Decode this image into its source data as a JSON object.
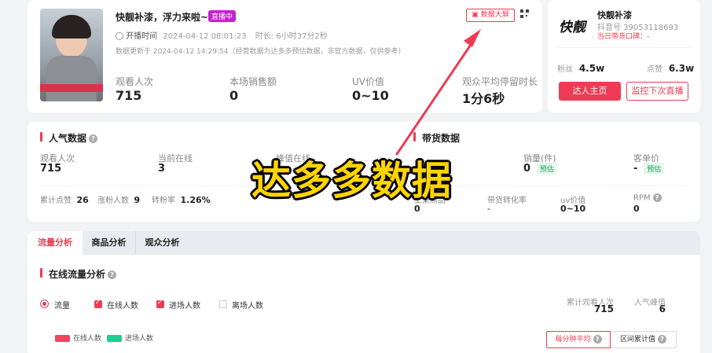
{
  "live": {
    "title": "快靓补漆，浮力来啦~",
    "status_badge": "直播中",
    "start_label": "开播时间",
    "start_time": "2024-04-12 08:01:23",
    "duration_label": "时长:",
    "duration": "6小时37分2秒",
    "update_note": "数据更新于 2024-04-12 14:29:54（经营数据为达多多预估数据，非官方数据，仅供参考）",
    "big_screen_label": "数据大屏",
    "stats": [
      {
        "label": "观看人次",
        "value": "715"
      },
      {
        "label": "本场销售额",
        "value": "0"
      },
      {
        "label": "UV价值",
        "value": "0~10"
      },
      {
        "label": "观众平均停留时长",
        "value": "1分6秒"
      }
    ]
  },
  "shop": {
    "logo_text": "快靓",
    "name": "快靓补漆",
    "douyin_id": "抖音号 39053118693",
    "today_label": "当日带货口碑：-",
    "fans_label": "粉丝",
    "fans_value": "4.5w",
    "likes_label": "点赞",
    "likes_value": "6.3w",
    "home_button": "达人主页",
    "monitor_button": "监控下次直播"
  },
  "popularity": {
    "title": "人气数据",
    "watch_label": "观看人次",
    "watch_value": "715",
    "online_label": "当前在线",
    "online_value": "3",
    "hidden_label": "峰值在线",
    "likes_label": "累计点赞",
    "likes_value": "26",
    "fans_label": "涨粉人数",
    "fans_value": "9",
    "conv_label": "转粉率",
    "conv_value": "1.26%"
  },
  "sales": {
    "title": "带货数据",
    "volume_label": "销量(件)",
    "volume_value": "0",
    "volume_tag": "预估",
    "price_label": "客单价",
    "price_value": "-",
    "price_tag": "预估",
    "products_label": "上架商品",
    "products_value": "0",
    "conv_label": "带货转化率",
    "conv_value": "-",
    "uv_label": "uv价值",
    "uv_value": "0~10",
    "rpm_label": "RPM",
    "rpm_value": "0"
  },
  "tabs": [
    "流量分析",
    "商品分析",
    "观众分析"
  ],
  "traffic": {
    "title": "在线流量分析",
    "radio_label": "流量",
    "checks": [
      {
        "label": "在线人数",
        "checked": true
      },
      {
        "label": "进场人数",
        "checked": true
      },
      {
        "label": "离场人数",
        "checked": false
      }
    ],
    "total_label": "累计观看人次",
    "total_value": "715",
    "peak_label": "人气峰值",
    "peak_value": "6",
    "legend": [
      {
        "label": "在线人数",
        "color": "#f2485f"
      },
      {
        "label": "进场人数",
        "color": "#1ccf8e"
      }
    ],
    "btn_per_minute": "每分钟平均",
    "btn_interval": "区间累计值"
  },
  "overlay": "达多多数据",
  "colors": {
    "accent": "#ee3b54",
    "green": "#17a05d",
    "arrow": "#ee3b54"
  }
}
